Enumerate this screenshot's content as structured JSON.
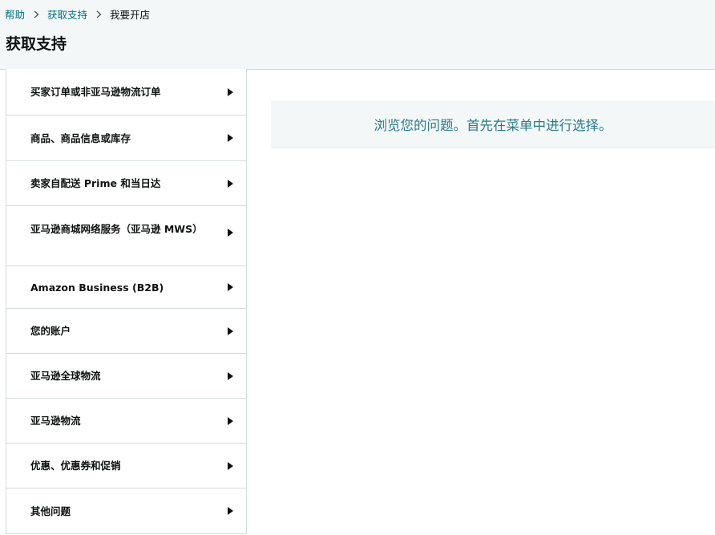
{
  "breadcrumb": {
    "items": [
      {
        "label": "帮助"
      },
      {
        "label": "获取支持"
      },
      {
        "label": "我要开店"
      }
    ]
  },
  "page": {
    "title": "获取支持"
  },
  "menu": {
    "items": [
      {
        "label": "买家订单或非亚马逊物流订单"
      },
      {
        "label": "商品、商品信息或库存"
      },
      {
        "label": "卖家自配送 Prime 和当日达"
      },
      {
        "label": "亚马逊商城网络服务（亚马逊 MWS）"
      },
      {
        "label": "Amazon Business (B2B)"
      },
      {
        "label": "您的账户"
      },
      {
        "label": "亚马逊全球物流"
      },
      {
        "label": "亚马逊物流"
      },
      {
        "label": "优惠、优惠券和促销"
      },
      {
        "label": "其他问题"
      }
    ]
  },
  "info": {
    "message": "浏览您的问题。首先在菜单中进行选择。"
  },
  "colors": {
    "link": "#007185",
    "header_bg": "#f3f7f8",
    "info_text": "#2b7b87",
    "border": "#d5dbdb"
  }
}
